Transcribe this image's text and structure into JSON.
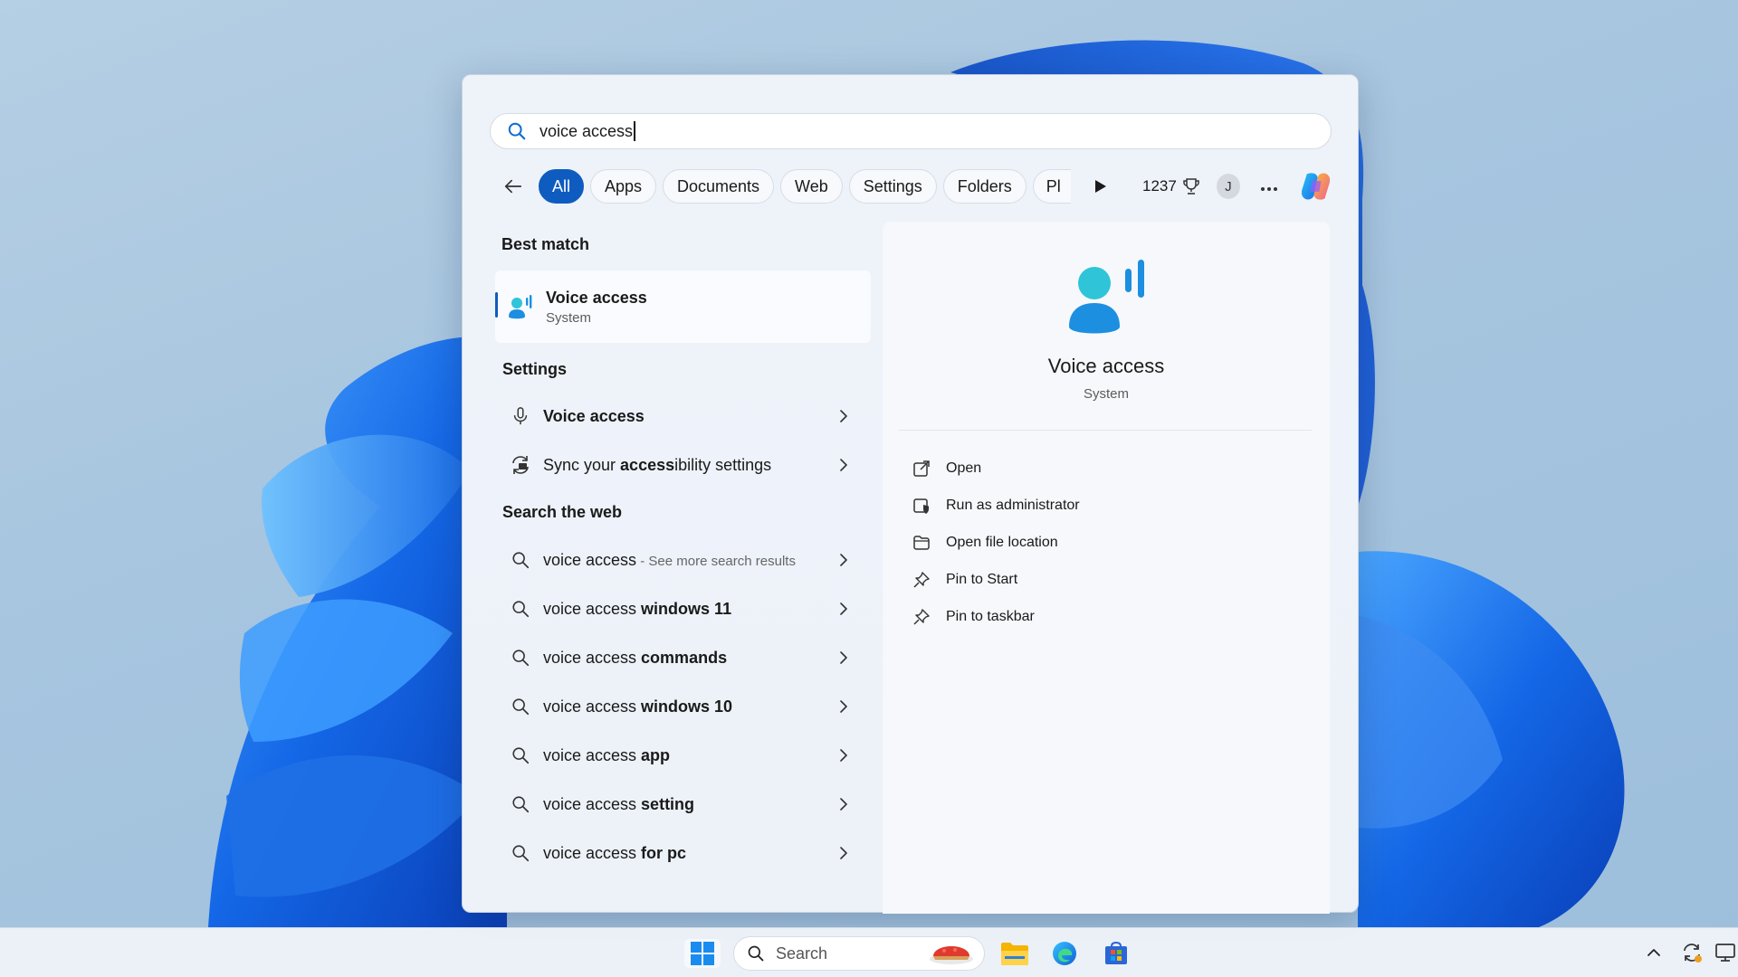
{
  "search": {
    "query": "voice access"
  },
  "filters": {
    "tabs": [
      "All",
      "Apps",
      "Documents",
      "Web",
      "Settings",
      "Folders"
    ],
    "partial_tab": "Pl",
    "points": "1237",
    "avatar_initial": "J"
  },
  "best_match": {
    "heading": "Best match",
    "title": "Voice access",
    "subtitle": "System"
  },
  "settings": {
    "heading": "Settings",
    "items": [
      {
        "label": "Voice access",
        "icon": "microphone-icon"
      },
      {
        "prefix": "Sync your ",
        "bold": "access",
        "suffix": "ibility settings",
        "icon": "sync-settings-icon"
      }
    ]
  },
  "web": {
    "heading": "Search the web",
    "first": {
      "label": "voice access",
      "hint": " - See more search results"
    },
    "items": [
      {
        "plain": "voice access ",
        "bold": "windows 11"
      },
      {
        "plain": "voice access ",
        "bold": "commands"
      },
      {
        "plain": "voice access ",
        "bold": "windows 10"
      },
      {
        "plain": "voice access ",
        "bold": "app"
      },
      {
        "plain": "voice access ",
        "bold": "setting"
      },
      {
        "plain": "voice access ",
        "bold": "for pc"
      }
    ]
  },
  "detail": {
    "title": "Voice access",
    "subtitle": "System",
    "actions": [
      {
        "label": "Open",
        "icon": "open-external-icon"
      },
      {
        "label": "Run as administrator",
        "icon": "admin-shield-icon"
      },
      {
        "label": "Open file location",
        "icon": "folder-icon"
      },
      {
        "label": "Pin to Start",
        "icon": "pin-icon"
      },
      {
        "label": "Pin to taskbar",
        "icon": "pin-icon"
      }
    ]
  },
  "taskbar": {
    "search_placeholder": "Search"
  },
  "colors": {
    "accent": "#0f5cc0",
    "voice_icon_head": "#2fc4d8",
    "voice_icon_body": "#1c8fe0"
  }
}
